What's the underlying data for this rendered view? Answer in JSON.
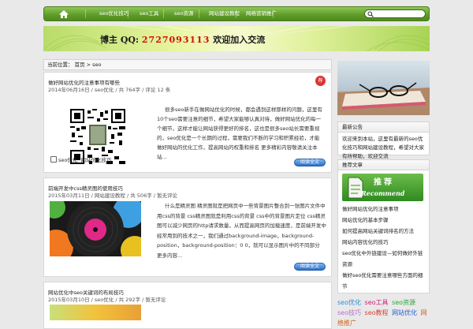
{
  "nav": {
    "items": [
      "seo优化技巧",
      "seo工具",
      "seo资源",
      "网站建设教程",
      "网络营销推广"
    ],
    "search_placeholder": ""
  },
  "banner": {
    "prefix": "博主 QQ:",
    "qq": "2727093113",
    "suffix": "欢迎加入交流"
  },
  "breadcrumb": "当前位置： 首页 > seo",
  "posts": [
    {
      "title": "做好网站优化的注意事项有哪些",
      "meta": "2014年06月16日 / seo优化 / 共 764字 / 评论 12 条",
      "badge": "荐",
      "excerpt": "很多seo新手在做网站优化的时候，都会遇到这样那样的问题，这里有10个seo需要注意的细节，希望大家能够认真对待，做好网站优化的每一个细节，这样才能让网站获得更好的排名，这也是很多seo站长需要重视的，seo优化是一个长期的过程，需要我们不断的学习和积累经验，才能做好网站的优化工作，提高网站的权重和排名 更多精彩内容敬请关注本站...",
      "tags_label": "seo优化",
      "tags": "网站优化技巧",
      "more": "阅读全文"
    },
    {
      "title": "前端开发中css精灵图的使用技巧",
      "meta": "2015年03月11日 / 网站建设教程 / 共 506字 / 暂无评论",
      "excerpt": "什么是精灵图 精灵图就是把网页中一些背景图片整合到一张图片文件中 用css的背景 css精灵图就是利用css的背景 css中的背景图片定位 css精灵图可以减少网页的http请求数量，从而提高网页的加载速度，是前端开发中经常用到的技术之一，我们通过background-image，background-position，background-position：0 0，就可以显示图片中的不同部分 更多内容...",
      "more": "阅读全文"
    },
    {
      "title": "网站优化中seo关键词的布局技巧",
      "meta": "2015年03月10日 / seo优化 / 共 292字 / 暂无评论"
    }
  ],
  "sidebar": {
    "widget1_title": "最新公告",
    "widget1_body": "欢迎来到本站，这里有最新的seo优化技巧和网站建设教程，希望对大家有所帮助，欢迎交流",
    "widget2_title": "推荐文章",
    "rec_word": "推荐",
    "rec_en": "Recommend",
    "rec_list": [
      "做好网站优化的注意事项",
      "网站优化的基本步骤",
      "如何提高网站关键词排名的方法",
      "网站内容优化的技巧",
      "seo优化中外链建设—如何做好外链资源",
      "做好seo优化需要注意哪些方面的细节"
    ],
    "cloud": [
      {
        "t": "seo优化",
        "c": "#2a8fd6"
      },
      {
        "t": "seo工具",
        "c": "#d0207a"
      },
      {
        "t": "seo资源",
        "c": "#2aa63a"
      },
      {
        "t": "seo技巧",
        "c": "#c06ad0"
      },
      {
        "t": "seo教程",
        "c": "#e0402a"
      },
      {
        "t": "网站优化",
        "c": "#2a60d0"
      },
      {
        "t": "网络推广",
        "c": "#d06020"
      }
    ]
  },
  "colors": {
    "nav_green": "#5e9b27",
    "button_blue": "#2d6fc9",
    "badge_red": "#d33333"
  }
}
